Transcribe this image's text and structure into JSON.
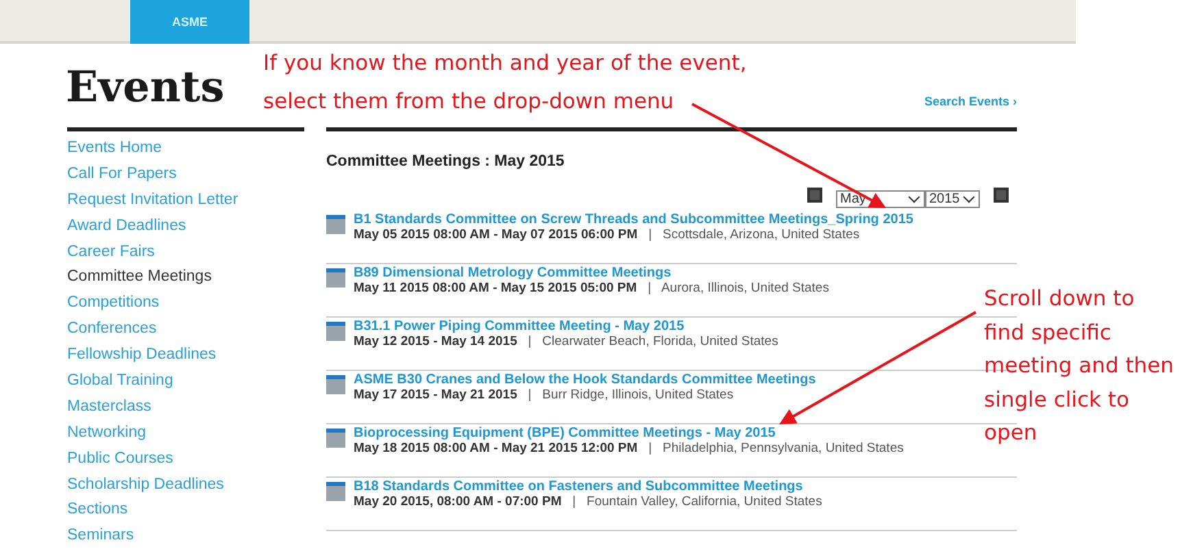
{
  "header": {
    "logo": "ASME"
  },
  "page_title": "Events",
  "search_link": "Search Events ›",
  "sidebar": {
    "items": [
      {
        "label": "Events Home",
        "selected": false
      },
      {
        "label": "Call For Papers",
        "selected": false
      },
      {
        "label": "Request Invitation Letter",
        "selected": false
      },
      {
        "label": "Award Deadlines",
        "selected": false
      },
      {
        "label": "Career Fairs",
        "selected": false
      },
      {
        "label": "Committee Meetings",
        "selected": true
      },
      {
        "label": "Competitions",
        "selected": false
      },
      {
        "label": "Conferences",
        "selected": false
      },
      {
        "label": "Fellowship Deadlines",
        "selected": false
      },
      {
        "label": "Global Training",
        "selected": false
      },
      {
        "label": "Masterclass",
        "selected": false
      },
      {
        "label": "Networking",
        "selected": false
      },
      {
        "label": "Public Courses",
        "selected": false
      },
      {
        "label": "Scholarship Deadlines",
        "selected": false
      },
      {
        "label": "Sections",
        "selected": false
      },
      {
        "label": "Seminars",
        "selected": false
      }
    ]
  },
  "section_heading": "Committee Meetings : May 2015",
  "filters": {
    "month": "May",
    "year": "2015"
  },
  "events": [
    {
      "title": "B1 Standards Committee on Screw Threads and Subcommittee Meetings_Spring 2015",
      "details": "**May 05 2015 08:00 AM - May 07 2015 06:00 PM**   |   Scottsdale, Arizona, United States"
    },
    {
      "title": "B89 Dimensional Metrology Committee Meetings",
      "details": "**May 11 2015 08:00 AM - May 15 2015 05:00 PM**   |   Aurora, Illinois, United States"
    },
    {
      "title": "B31.1 Power Piping Committee Meeting - May 2015",
      "details": "**May 12 2015 - May 14 2015**   |   Clearwater Beach, Florida, United States"
    },
    {
      "title": "ASME B30 Cranes and Below the Hook Standards Committee Meetings",
      "details": "**May 17 2015 - May 21 2015**   |   Burr Ridge, Illinois, United States"
    },
    {
      "title": "Bioprocessing Equipment (BPE) Committee Meetings - May 2015",
      "details": "**May 18 2015 08:00 AM - May 21 2015 12:00 PM**   |   Philadelphia, Pennsylvania, United States"
    },
    {
      "title": "B18 Standards Committee on Fasteners and Subcommittee Meetings",
      "details": "**May 20 2015, 08:00 AM - 07:00 PM**   |   Fountain Valley, California, United States"
    }
  ],
  "annotations": [
    {
      "kind": "top",
      "text": "If you know the month and year of the event, select them from the drop-down menu"
    },
    {
      "kind": "side",
      "text": "Scroll down to find specific meeting and then single click to open"
    }
  ]
}
